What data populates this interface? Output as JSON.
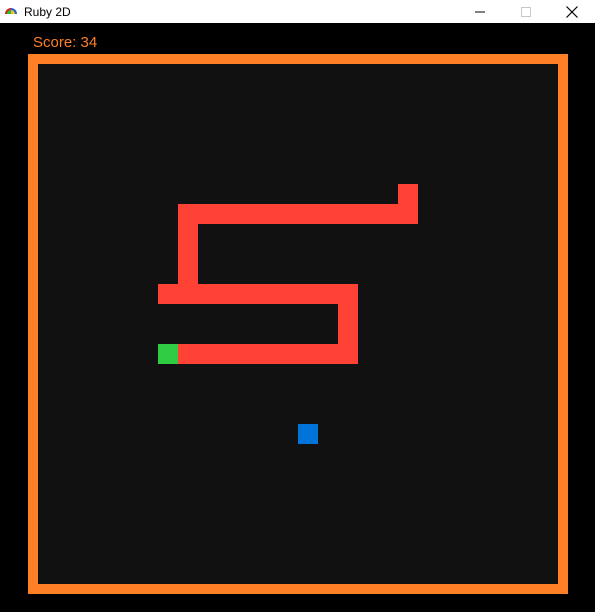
{
  "window": {
    "title": "Ruby 2D",
    "minimize_icon": "minimize-icon",
    "maximize_icon": "maximize-icon",
    "close_icon": "close-icon"
  },
  "game": {
    "score_text": "Score: 34",
    "grid": {
      "columns": 26,
      "rows": 26
    },
    "colors": {
      "background": "#000000",
      "border": "#ff7f27",
      "field": "#111111",
      "snake_body": "#ff4136",
      "snake_head": "#2ecc40",
      "food": "#0074d9",
      "score": "#ff7f27"
    },
    "snake": {
      "head": [
        6,
        14
      ],
      "body": [
        [
          7,
          14
        ],
        [
          8,
          14
        ],
        [
          9,
          14
        ],
        [
          10,
          14
        ],
        [
          11,
          14
        ],
        [
          12,
          14
        ],
        [
          13,
          14
        ],
        [
          14,
          14
        ],
        [
          15,
          14
        ],
        [
          15,
          13
        ],
        [
          15,
          12
        ],
        [
          14,
          11
        ],
        [
          13,
          11
        ],
        [
          12,
          11
        ],
        [
          11,
          11
        ],
        [
          10,
          11
        ],
        [
          9,
          11
        ],
        [
          8,
          11
        ],
        [
          7,
          11
        ],
        [
          7,
          10
        ],
        [
          7,
          9
        ],
        [
          7,
          8
        ],
        [
          8,
          7
        ],
        [
          9,
          7
        ],
        [
          10,
          7
        ],
        [
          11,
          7
        ],
        [
          12,
          7
        ],
        [
          13,
          7
        ],
        [
          14,
          7
        ],
        [
          15,
          7
        ],
        [
          16,
          7
        ],
        [
          17,
          7
        ],
        [
          18,
          7
        ],
        [
          18,
          6
        ]
      ],
      "corners": [
        [
          15,
          11
        ],
        [
          6,
          11
        ],
        [
          7,
          7
        ]
      ]
    },
    "food": [
      13,
      18
    ]
  }
}
